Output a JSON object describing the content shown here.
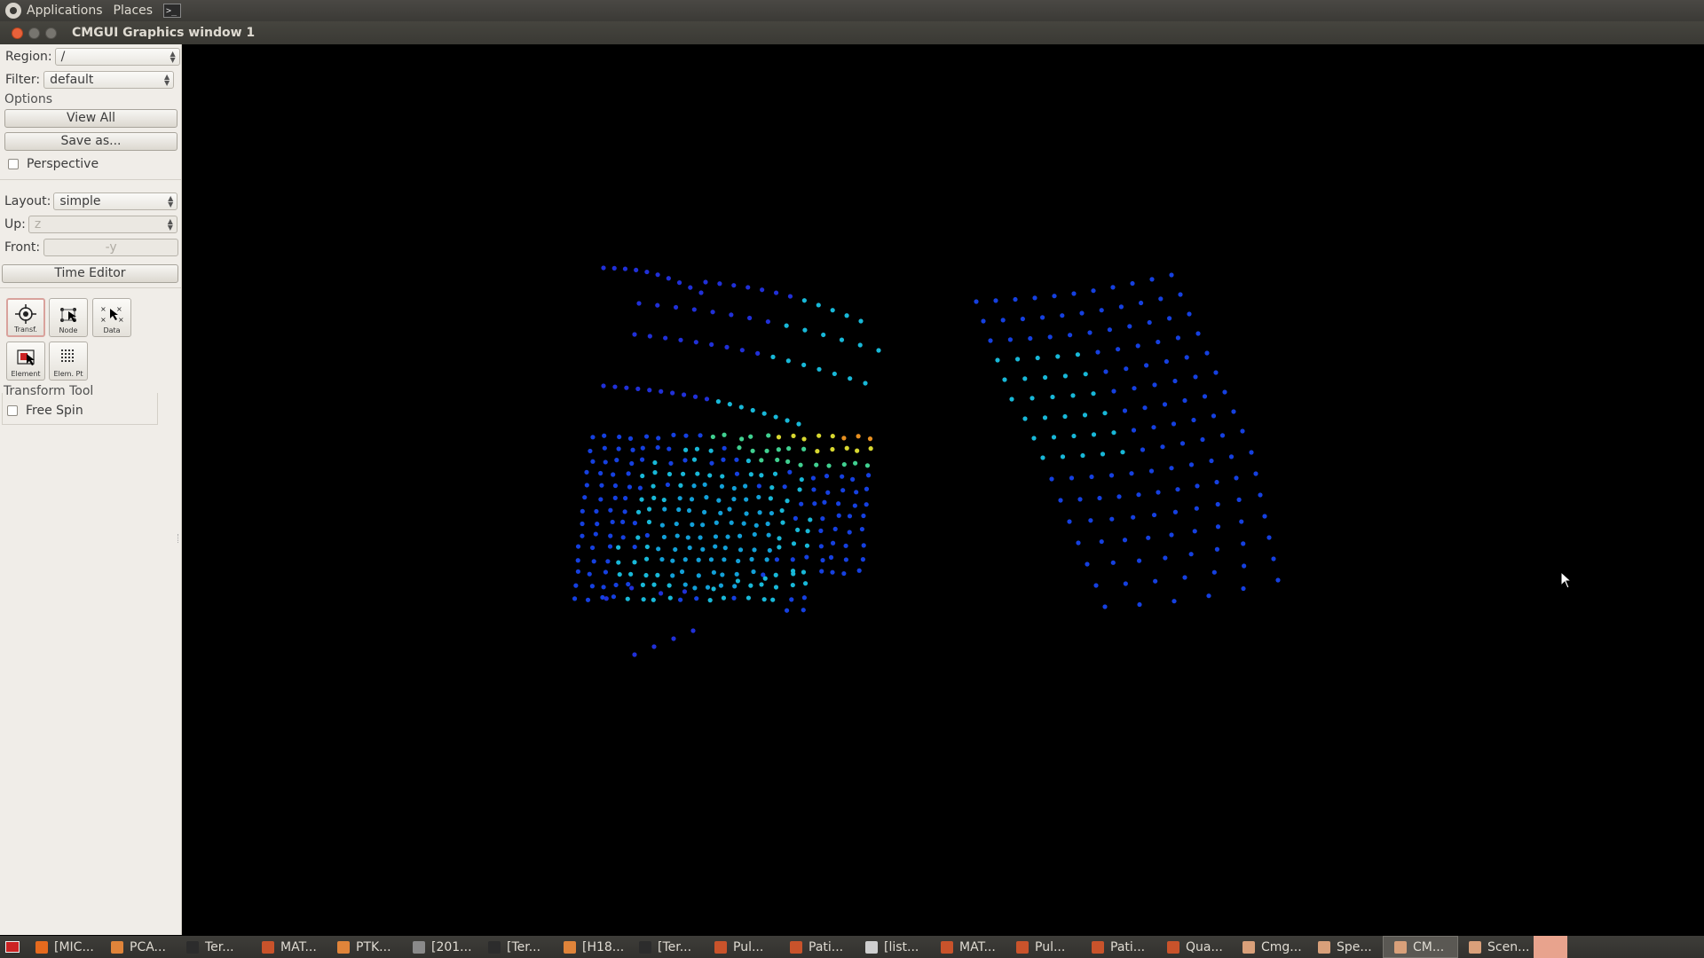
{
  "top_panel": {
    "applications": "Applications",
    "places": "Places"
  },
  "window": {
    "title": "CMGUI Graphics window 1"
  },
  "sidebar": {
    "region_label": "Region:",
    "region_value": "/",
    "filter_label": "Filter:",
    "filter_value": "default",
    "options_label": "Options",
    "view_all": "View All",
    "save_as": "Save as...",
    "perspective_label": "Perspective",
    "layout_label": "Layout:",
    "layout_value": "simple",
    "up_label": "Up:",
    "up_value": "z",
    "front_label": "Front:",
    "front_value": "-y",
    "time_editor": "Time Editor",
    "tools": [
      "Transf.",
      "Node",
      "Data",
      "Element",
      "Elem. Pt"
    ],
    "transform_tool_label": "Transform Tool",
    "free_spin_label": "Free Spin"
  },
  "taskbar": [
    {
      "label": "[MIC...",
      "icon": "firefox-icon",
      "color": "#e66a1e"
    },
    {
      "label": "PCA...",
      "icon": "folder-icon",
      "color": "#e0843a"
    },
    {
      "label": "Ter...",
      "icon": "terminal-icon",
      "color": "#2c2c2c"
    },
    {
      "label": "MAT...",
      "icon": "matlab-icon",
      "color": "#c9532b"
    },
    {
      "label": "PTK...",
      "icon": "folder-icon",
      "color": "#e0843a"
    },
    {
      "label": "[201...",
      "icon": "image-icon",
      "color": "#8a8a8a"
    },
    {
      "label": "[Ter...",
      "icon": "terminal-icon",
      "color": "#2c2c2c"
    },
    {
      "label": "[H18...",
      "icon": "folder-icon",
      "color": "#e0843a"
    },
    {
      "label": "[Ter...",
      "icon": "terminal-icon",
      "color": "#2c2c2c"
    },
    {
      "label": "Pul...",
      "icon": "matlab-figure-icon",
      "color": "#c9532b"
    },
    {
      "label": "Pati...",
      "icon": "matlab-figure-icon",
      "color": "#c9532b"
    },
    {
      "label": "[list...",
      "icon": "text-editor-icon",
      "color": "#cfcfcf"
    },
    {
      "label": "MAT...",
      "icon": "matlab-icon",
      "color": "#c9532b"
    },
    {
      "label": "Pul...",
      "icon": "matlab-figure-icon",
      "color": "#c9532b"
    },
    {
      "label": "Pati...",
      "icon": "matlab-figure-icon",
      "color": "#c9532b"
    },
    {
      "label": "Qua...",
      "icon": "matlab-figure-icon",
      "color": "#c9532b"
    },
    {
      "label": "Cmg...",
      "icon": "cmgui-icon",
      "color": "#d9a07a"
    },
    {
      "label": "Spe...",
      "icon": "cmgui-icon",
      "color": "#d9a07a"
    },
    {
      "label": "CM...",
      "icon": "cmgui-icon",
      "color": "#d9a07a",
      "active": true
    },
    {
      "label": "Scen...",
      "icon": "cmgui-icon",
      "color": "#d9a07a"
    }
  ],
  "colors": {
    "accent_close": "#e8613a",
    "viewport_bg": "#000000"
  }
}
